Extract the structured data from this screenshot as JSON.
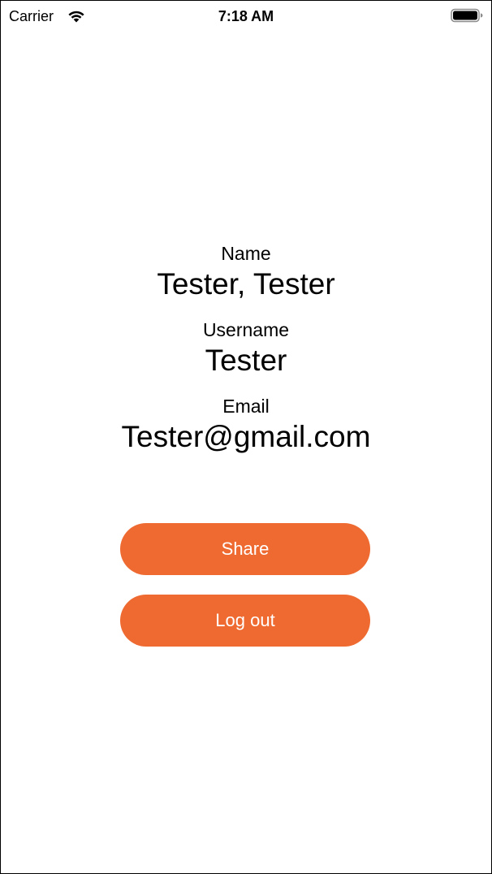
{
  "status_bar": {
    "carrier": "Carrier",
    "time": "7:18 AM",
    "wifi_icon": "wifi-icon",
    "battery_icon": "battery-icon"
  },
  "profile": {
    "name_label": "Name",
    "name_value": "Tester, Tester",
    "username_label": "Username",
    "username_value": "Tester",
    "email_label": "Email",
    "email_value": "Tester@gmail.com"
  },
  "actions": {
    "share_label": "Share",
    "logout_label": "Log out"
  },
  "colors": {
    "accent": "#ef6a30",
    "button_text": "#ffffff",
    "background": "#ffffff",
    "text": "#000000"
  }
}
